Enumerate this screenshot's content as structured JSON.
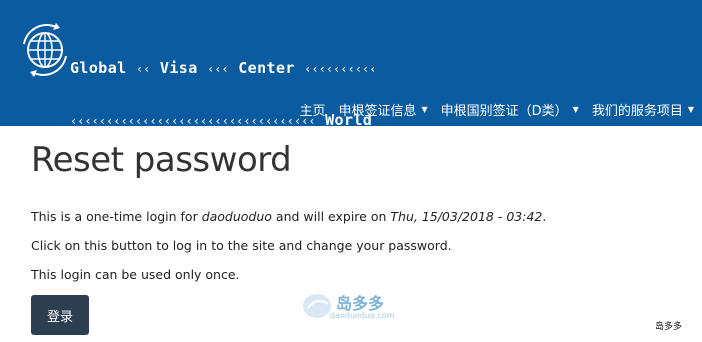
{
  "brand": {
    "line1_word1": "Global",
    "line1_chev1": "‹‹",
    "line1_word2": "Visa",
    "line1_chev2": "‹‹‹",
    "line1_word3": "Center",
    "line1_chev3": "‹‹‹‹‹‹‹‹‹‹",
    "line2_chev": "‹‹‹‹‹‹‹‹‹‹‹‹‹‹‹‹‹‹‹‹‹‹‹‹‹‹‹‹‹‹‹‹‹‹",
    "line2_word": "World"
  },
  "nav": {
    "items": [
      {
        "label": "主页",
        "has_dropdown": false
      },
      {
        "label": "申根签证信息",
        "has_dropdown": true
      },
      {
        "label": "申根国别签证（D类）",
        "has_dropdown": true
      },
      {
        "label": "我们的服务项目",
        "has_dropdown": true
      }
    ],
    "caret": "▼"
  },
  "page": {
    "title": "Reset password",
    "p1_pre": "This is a one-time login for ",
    "p1_user": "daoduoduo",
    "p1_mid": " and will expire on ",
    "p1_date": "Thu, 15/03/2018 - 03:42",
    "p1_end": ".",
    "p2": "Click on this button to log in to the site and change your password.",
    "p3": "This login can be used only once.",
    "login_button": "登录"
  },
  "watermark": {
    "text": "岛多多",
    "sub": "daoduoduo.com"
  },
  "corner_mark": "岛多多",
  "colors": {
    "header_bg": "#0a5ba0",
    "button_bg": "#2c3e50"
  }
}
